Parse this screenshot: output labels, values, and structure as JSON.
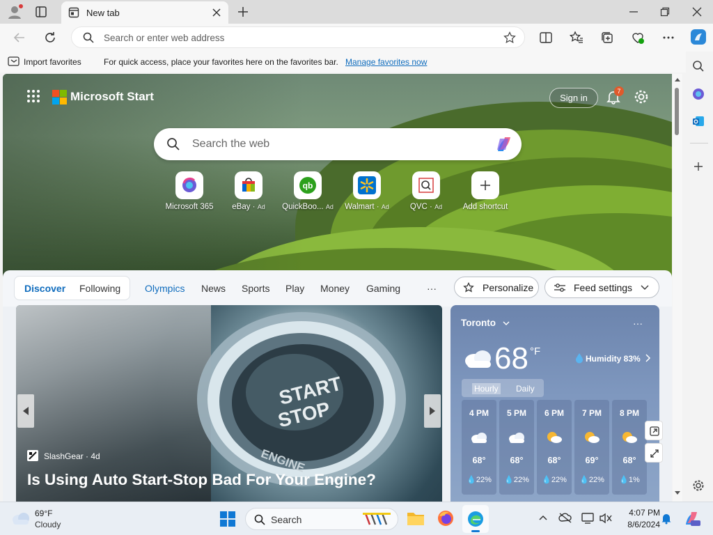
{
  "browser": {
    "tab": {
      "title": "New tab"
    },
    "address": {
      "placeholder": "Search or enter web address"
    },
    "favorites_bar": {
      "import_label": "Import favorites",
      "message": "For quick access, place your favorites here on the favorites bar.",
      "manage_link": "Manage favorites now"
    },
    "sidebar_icons": [
      "search-icon",
      "copilot-icon",
      "outlook-icon",
      "add-icon",
      "settings-icon"
    ]
  },
  "start": {
    "brand": "Microsoft Start",
    "sign_in": "Sign in",
    "notification_count": "7",
    "search_placeholder": "Search the web",
    "shortcuts": [
      {
        "label": "Microsoft 365",
        "ad": ""
      },
      {
        "label": "eBay",
        "ad": "Ad"
      },
      {
        "label": "QuickBoo...",
        "ad": "Ad"
      },
      {
        "label": "Walmart",
        "ad": "Ad"
      },
      {
        "label": "QVC",
        "ad": "Ad"
      },
      {
        "label": "Add shortcut",
        "ad": ""
      }
    ]
  },
  "feed_nav": {
    "tabs": [
      "Discover",
      "Following"
    ],
    "categories": [
      "Olympics",
      "News",
      "Sports",
      "Play",
      "Money",
      "Gaming"
    ],
    "more": "···",
    "personalize": "Personalize",
    "feed_settings": "Feed settings"
  },
  "main_story": {
    "source": "SlashGear · 4d",
    "headline": "Is Using Auto Start-Stop Bad For Your Engine?",
    "button_text_1": "START",
    "button_text_2": "STOP",
    "button_text_3": "ENGINE"
  },
  "weather": {
    "city": "Toronto",
    "temp": "68",
    "unit": "°F",
    "humidity": "Humidity 83%",
    "tabs": [
      "Hourly",
      "Daily"
    ],
    "hours": [
      {
        "time": "4 PM",
        "temp": "68°",
        "precip": "22%"
      },
      {
        "time": "5 PM",
        "temp": "68°",
        "precip": "22%"
      },
      {
        "time": "6 PM",
        "temp": "68°",
        "precip": "22%"
      },
      {
        "time": "7 PM",
        "temp": "69°",
        "precip": "22%"
      },
      {
        "time": "8 PM",
        "temp": "68°",
        "precip": "1%"
      }
    ]
  },
  "taskbar": {
    "weather_temp": "69°F",
    "weather_cond": "Cloudy",
    "search_label": "Search",
    "time": "4:07 PM",
    "date": "8/6/2024"
  },
  "colors": {
    "accent": "#0067c0",
    "link": "#0f6cbd",
    "badge": "#e05a2b"
  }
}
